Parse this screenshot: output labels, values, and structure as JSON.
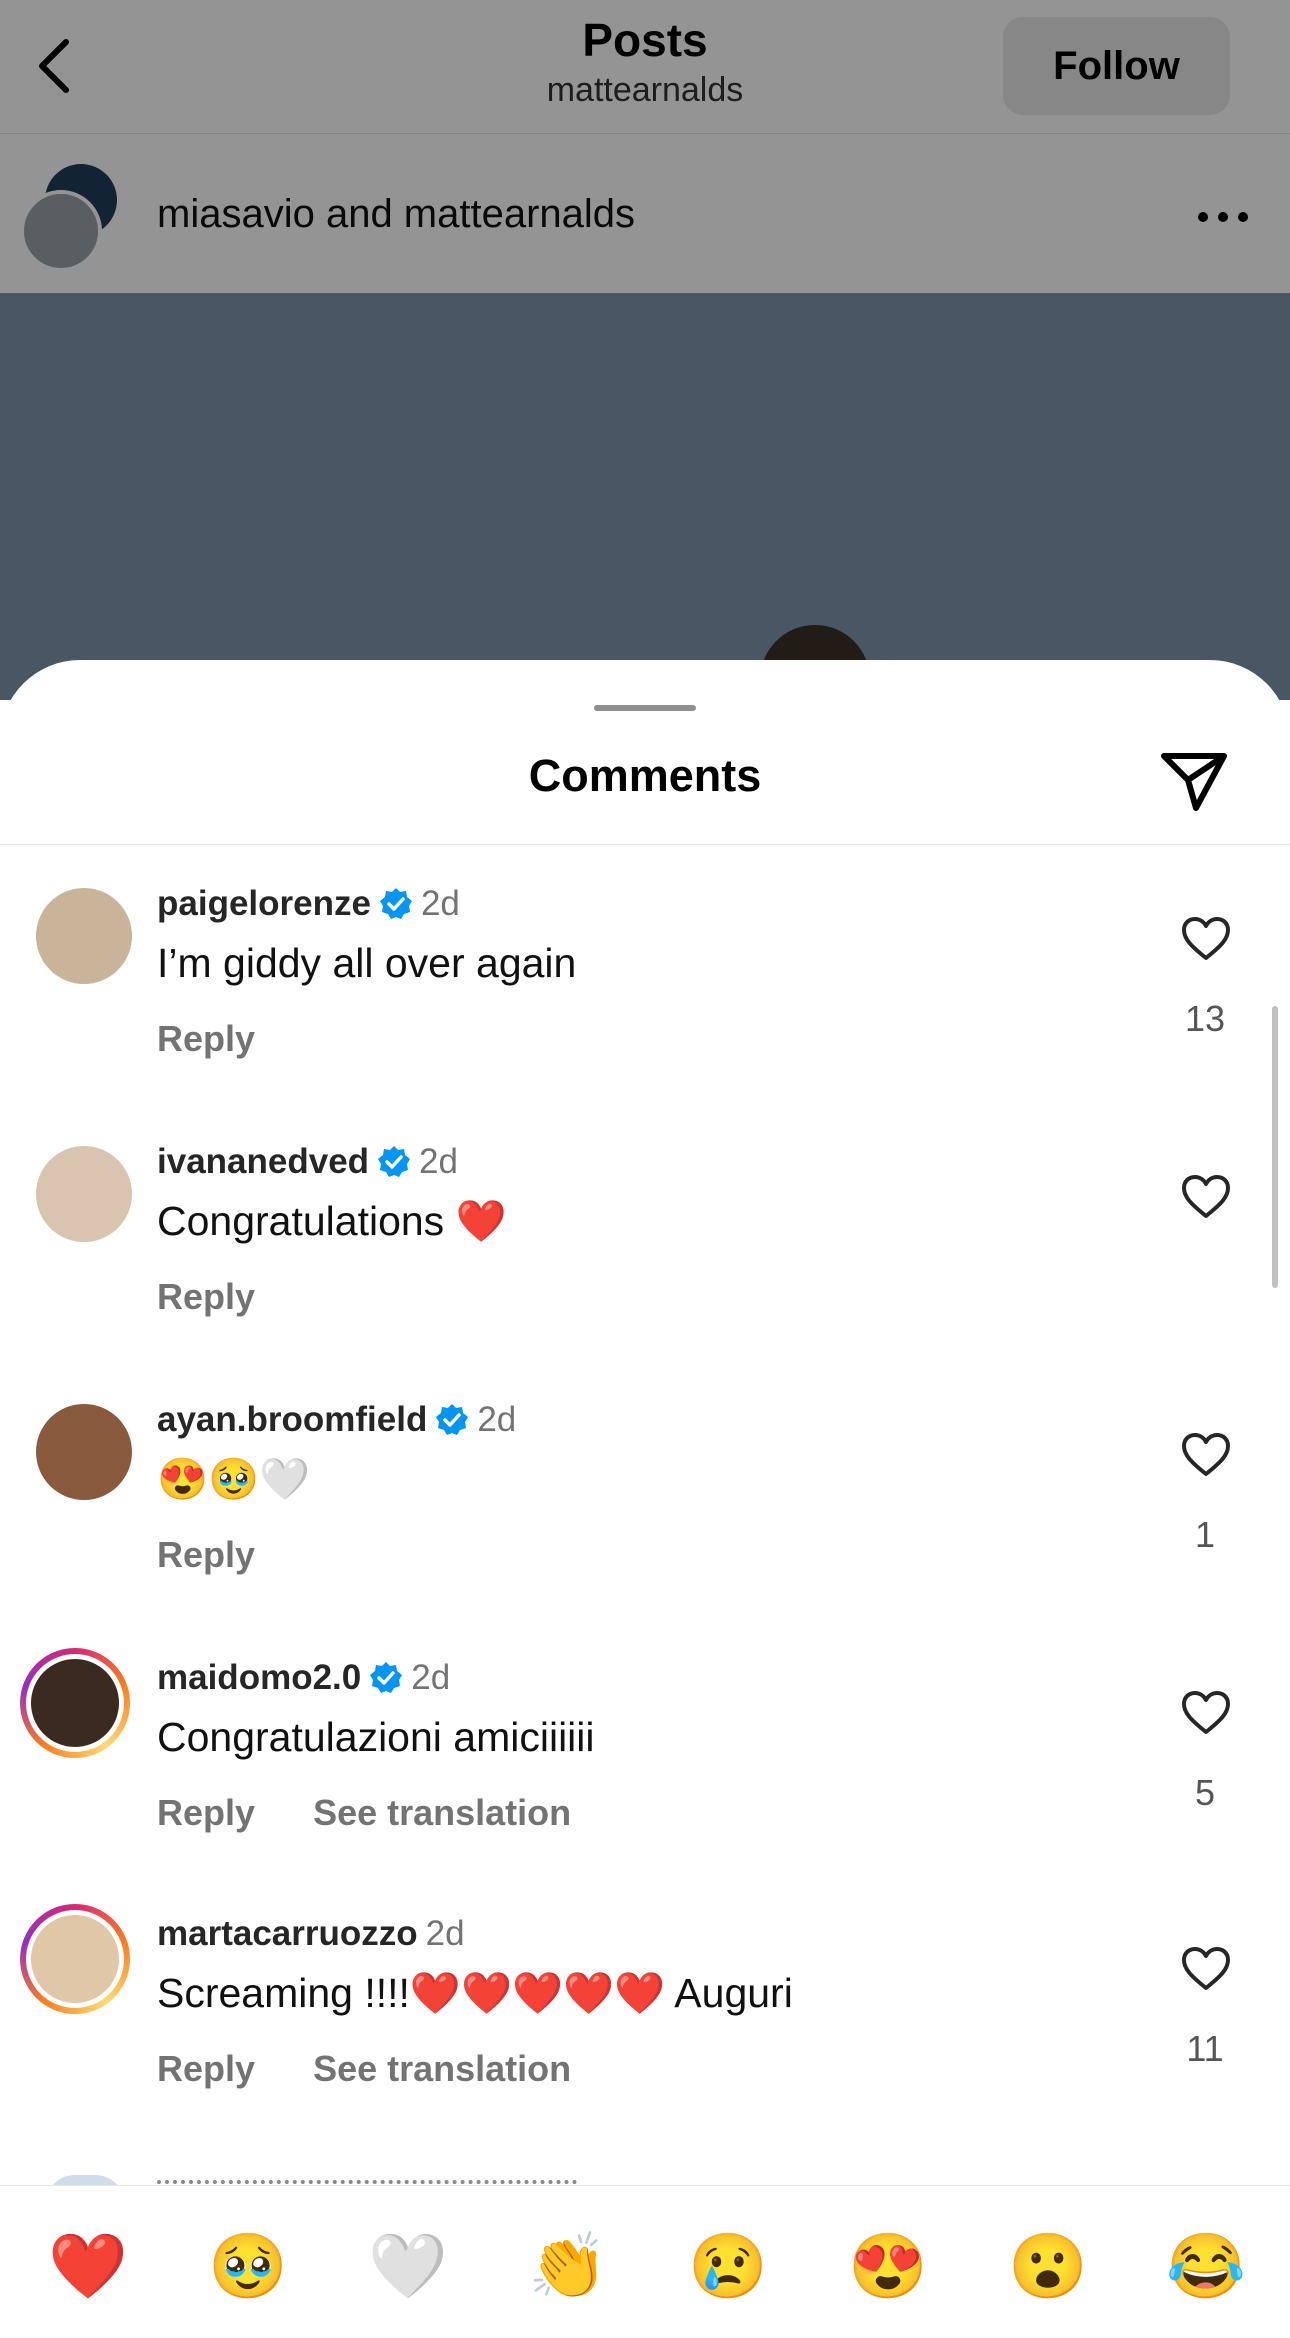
{
  "header": {
    "title": "Posts",
    "subtitle": "mattearnalds",
    "follow_label": "Follow"
  },
  "post": {
    "author_line": "miasavio and mattearnalds"
  },
  "sheet": {
    "title": "Comments"
  },
  "colors": {
    "accent_blue": "#0095f6",
    "heart_red": "#e3213b",
    "secondary_text": "#737373"
  },
  "comments": [
    {
      "user": "paigelorenze",
      "verified": true,
      "time": "2d",
      "text": "I’m giddy all over again",
      "reply": "Reply",
      "see_translation": "",
      "likes": "13"
    },
    {
      "user": "ivananedved",
      "verified": true,
      "time": "2d",
      "text": "Congratulations ❤️",
      "reply": "Reply",
      "see_translation": "",
      "likes": ""
    },
    {
      "user": "ayan.broomfield",
      "verified": true,
      "time": "2d",
      "text": "😍🥹🤍",
      "reply": "Reply",
      "see_translation": "",
      "likes": "1"
    },
    {
      "user": "maidomo2.0",
      "verified": true,
      "time": "2d",
      "text": "Congratulazioni amiciiiiii",
      "reply": "Reply",
      "see_translation": "See translation",
      "likes": "5"
    },
    {
      "user": "martacarruozzo",
      "verified": false,
      "time": "2d",
      "text": "Screaming !!!!❤️❤️❤️❤️❤️ Auguri",
      "reply": "Reply",
      "see_translation": "See translation",
      "likes": "11"
    }
  ],
  "reactions": [
    "❤️",
    "🥹",
    "🤍",
    "👏",
    "😢",
    "😍",
    "😮",
    "😂"
  ]
}
